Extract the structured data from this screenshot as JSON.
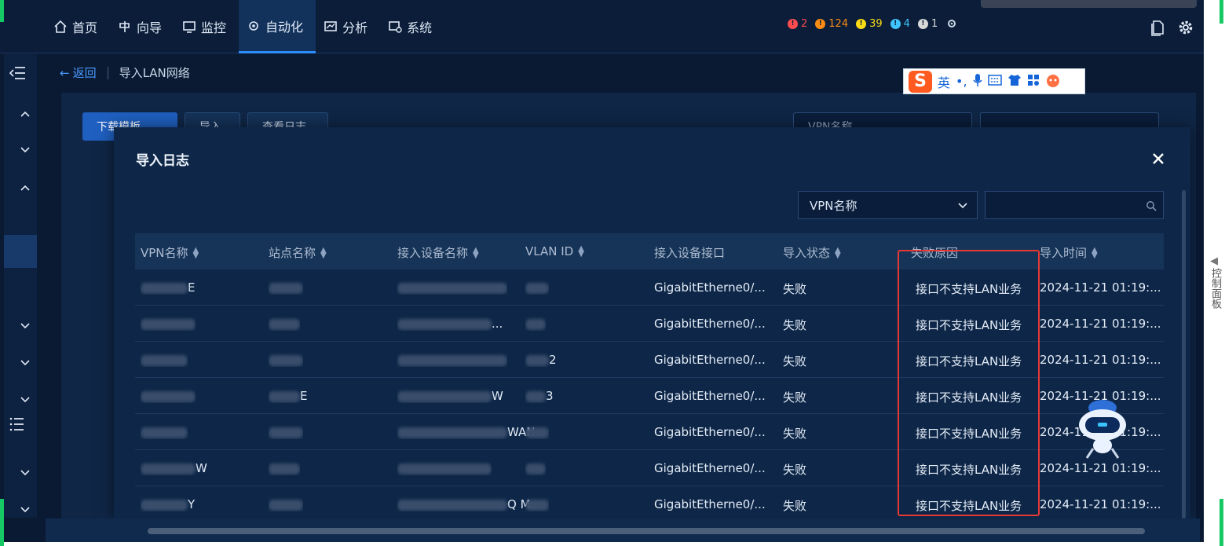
{
  "nav": {
    "items": [
      {
        "label": "首页",
        "icon": "home-icon"
      },
      {
        "label": "向导",
        "icon": "guide-icon"
      },
      {
        "label": "监控",
        "icon": "monitor-icon"
      },
      {
        "label": "自动化",
        "icon": "automation-icon",
        "active": true
      },
      {
        "label": "分析",
        "icon": "analysis-icon"
      },
      {
        "label": "系统",
        "icon": "system-icon"
      }
    ],
    "alarms": [
      {
        "count": "2",
        "color": "#ff4d4f"
      },
      {
        "count": "124",
        "color": "#fa8c16"
      },
      {
        "count": "39",
        "color": "#fadb14"
      },
      {
        "count": "4",
        "color": "#40c4ff"
      },
      {
        "count": "1",
        "color": "#d9d9d9"
      }
    ]
  },
  "breadcrumb": {
    "back": "返回",
    "current": "导入LAN网络"
  },
  "background": {
    "download_button": "下载模板",
    "import_button": "导入",
    "view_log_button": "查看日志",
    "vpn_select": "VPN名称"
  },
  "ime": {
    "lang": "英"
  },
  "dialog": {
    "title": "导入日志",
    "filter_select": "VPN名称",
    "columns": [
      "VPN名称",
      "站点名称",
      "接入设备名称",
      "VLAN ID",
      "接入设备接口",
      "导入状态",
      "失败原因",
      "导入时间"
    ],
    "rows": [
      {
        "vpn": "E",
        "site": "",
        "device": "",
        "vlan": "",
        "interface": "GigabitEtherne0/...",
        "status": "失败",
        "reason": "接口不支持LAN业务",
        "time": "2024-11-21 01:19:..."
      },
      {
        "vpn": "",
        "site": "",
        "device": "...",
        "vlan": "",
        "interface": "GigabitEtherne0/...",
        "status": "失败",
        "reason": "接口不支持LAN业务",
        "time": "2024-11-21 01:19:..."
      },
      {
        "vpn": "",
        "site": "",
        "device": "",
        "vlan": "2",
        "interface": "GigabitEtherne0/...",
        "status": "失败",
        "reason": "接口不支持LAN业务",
        "time": "2024-11-21 01:19:..."
      },
      {
        "vpn": "",
        "site": "E",
        "device": "W",
        "vlan": "3",
        "interface": "GigabitEtherne0/...",
        "status": "失败",
        "reason": "接口不支持LAN业务",
        "time": "2024-11-21 01:19:..."
      },
      {
        "vpn": "",
        "site": "",
        "device": "WAN",
        "vlan": "",
        "interface": "GigabitEtherne0/...",
        "status": "失败",
        "reason": "接口不支持LAN业务",
        "time": "2024-11-21 01:19:..."
      },
      {
        "vpn": "W",
        "site": "",
        "device": "",
        "vlan": "",
        "interface": "GigabitEtherne0/...",
        "status": "失败",
        "reason": "接口不支持LAN业务",
        "time": "2024-11-21 01:19:..."
      },
      {
        "vpn": "Y",
        "site": "",
        "device": "Q M...",
        "vlan": "",
        "interface": "GigabitEtherne0/...",
        "status": "失败",
        "reason": "接口不支持LAN业务",
        "time": "2024-11-21 01:19:..."
      }
    ]
  },
  "right_panel": {
    "label": "控制面板"
  }
}
